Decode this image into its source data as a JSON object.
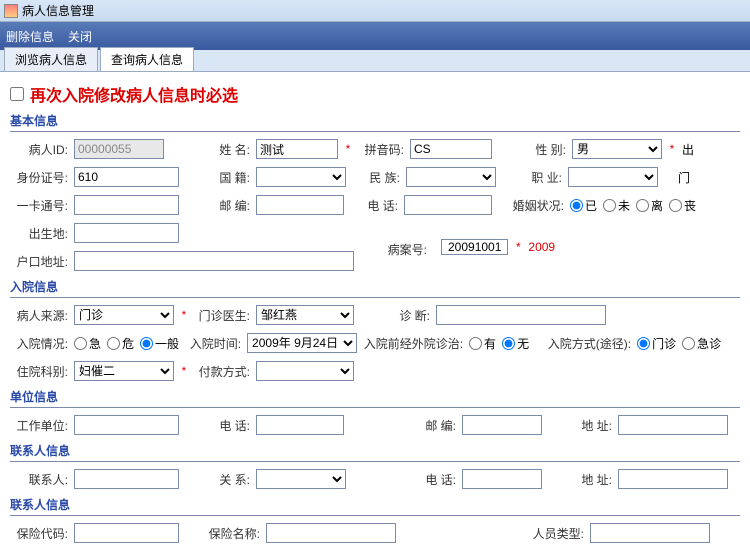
{
  "titlebar": {
    "title": "病人信息管理"
  },
  "menu": {
    "delete": "删除信息",
    "close": "关闭"
  },
  "tabs": {
    "browse": "浏览病人信息",
    "search": "查询病人信息"
  },
  "headline": "再次入院修改病人信息时必选",
  "sections": {
    "basic": "基本信息",
    "admission": "入院信息",
    "work": "单位信息",
    "contact": "联系人信息",
    "contact2": "联系人信息"
  },
  "labels": {
    "patientId": "病人ID:",
    "name": "姓  名:",
    "pinyin": "拼音码:",
    "gender": "性 别:",
    "idCard": "身份证号:",
    "nationality": "国  籍:",
    "ethnicity": "民  族:",
    "occupation": "职  业:",
    "cardNo": "一卡通号:",
    "postcode": "邮  编:",
    "phone": "电  话:",
    "marital": "婚姻状况:",
    "birthplace": "出生地:",
    "caseNo": "病案号:",
    "household": "户口地址:",
    "source": "病人来源:",
    "outDoctor": "门诊医生:",
    "diagnosis": "诊  断:",
    "admissionCond": "入院情况:",
    "admissionTime": "入院时间:",
    "preTreatment": "入院前经外院诊治:",
    "admissionWay": "入院方式(途径):",
    "dept": "住院科别:",
    "payment": "付款方式:",
    "workUnit": "工作单位:",
    "addr": "地  址:",
    "contactName": "联系人:",
    "relation": "关  系:",
    "insCode": "保险代码:",
    "insName": "保险名称:",
    "personType": "人员类型:",
    "cutoff_out": "出",
    "cutoff_men": "门"
  },
  "values": {
    "patientId": "00000055",
    "name": "测试",
    "pinyin": "CS",
    "gender": "男",
    "idCard": "610",
    "source": "门诊",
    "outDoctor": "邹红燕",
    "admissionTime": "2009年 9月24日",
    "dept": "妇催二",
    "caseNoBig": "20091001",
    "caseNoRed": "2009"
  },
  "radios": {
    "marital": {
      "yes": "已",
      "no": "未",
      "div": "离",
      "widow": "丧"
    },
    "admissionCond": {
      "urgent": "急",
      "critical": "危",
      "normal": "一般"
    },
    "preTreatment": {
      "yes": "有",
      "no": "无"
    },
    "admissionWay": {
      "outpatient": "门诊",
      "emergency": "急诊"
    }
  }
}
